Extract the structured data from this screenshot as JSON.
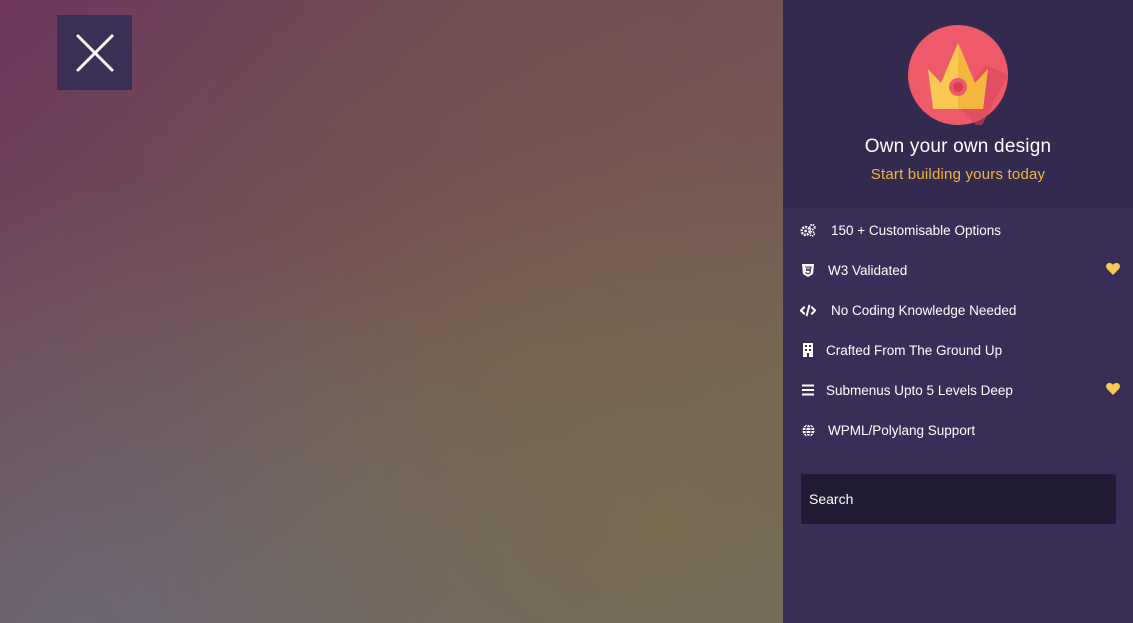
{
  "close_button": {
    "icon": "close-icon",
    "label": ""
  },
  "panel": {
    "logo": {
      "icon": "crown-icon",
      "circle_color": "#ee5a6a",
      "crown_color": "#f9c953"
    },
    "title": "Own your own design",
    "subtitle": "Start building yours today",
    "accent_color": "#f4b43f",
    "background": "#3a2d58"
  },
  "menu": {
    "items": [
      {
        "label": "150 + Customisable Options",
        "icon": "gears-icon",
        "favorite": false
      },
      {
        "label": "W3 Validated",
        "icon": "css3-icon",
        "favorite": true
      },
      {
        "label": "No Coding Knowledge Needed",
        "icon": "code-icon",
        "favorite": false
      },
      {
        "label": "Crafted From The Ground Up",
        "icon": "building-icon",
        "favorite": false
      },
      {
        "label": "Submenus Upto 5 Levels Deep",
        "icon": "bars-icon",
        "favorite": true
      },
      {
        "label": "WPML/Polylang Support",
        "icon": "globe-icon",
        "favorite": false
      }
    ]
  },
  "search": {
    "placeholder": "Search",
    "value": ""
  }
}
